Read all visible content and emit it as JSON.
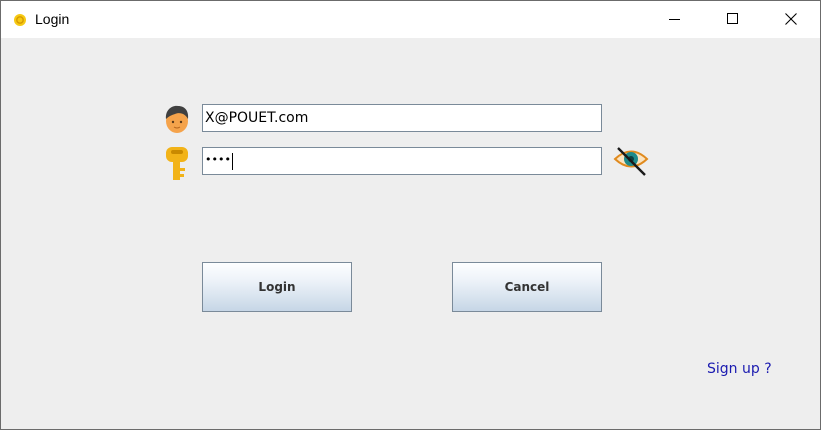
{
  "window": {
    "title": "Login",
    "app_icon": "java-cup-icon",
    "controls": [
      "minimize-icon",
      "maximize-icon",
      "close-icon"
    ]
  },
  "form": {
    "email_icon": "user-avatar-icon",
    "email_value": "X@POUET.com",
    "password_icon": "key-icon",
    "password_masked": "••••",
    "toggle_icon": "eye-slash-icon"
  },
  "buttons": {
    "login_label": "Login",
    "cancel_label": "Cancel"
  },
  "links": {
    "signup_label": "Sign up ?"
  },
  "colors": {
    "window_bg": "#eeeeee",
    "link": "#1a1ab0",
    "button_border": "#7a8a99",
    "icon_gold": "#f2b318"
  }
}
